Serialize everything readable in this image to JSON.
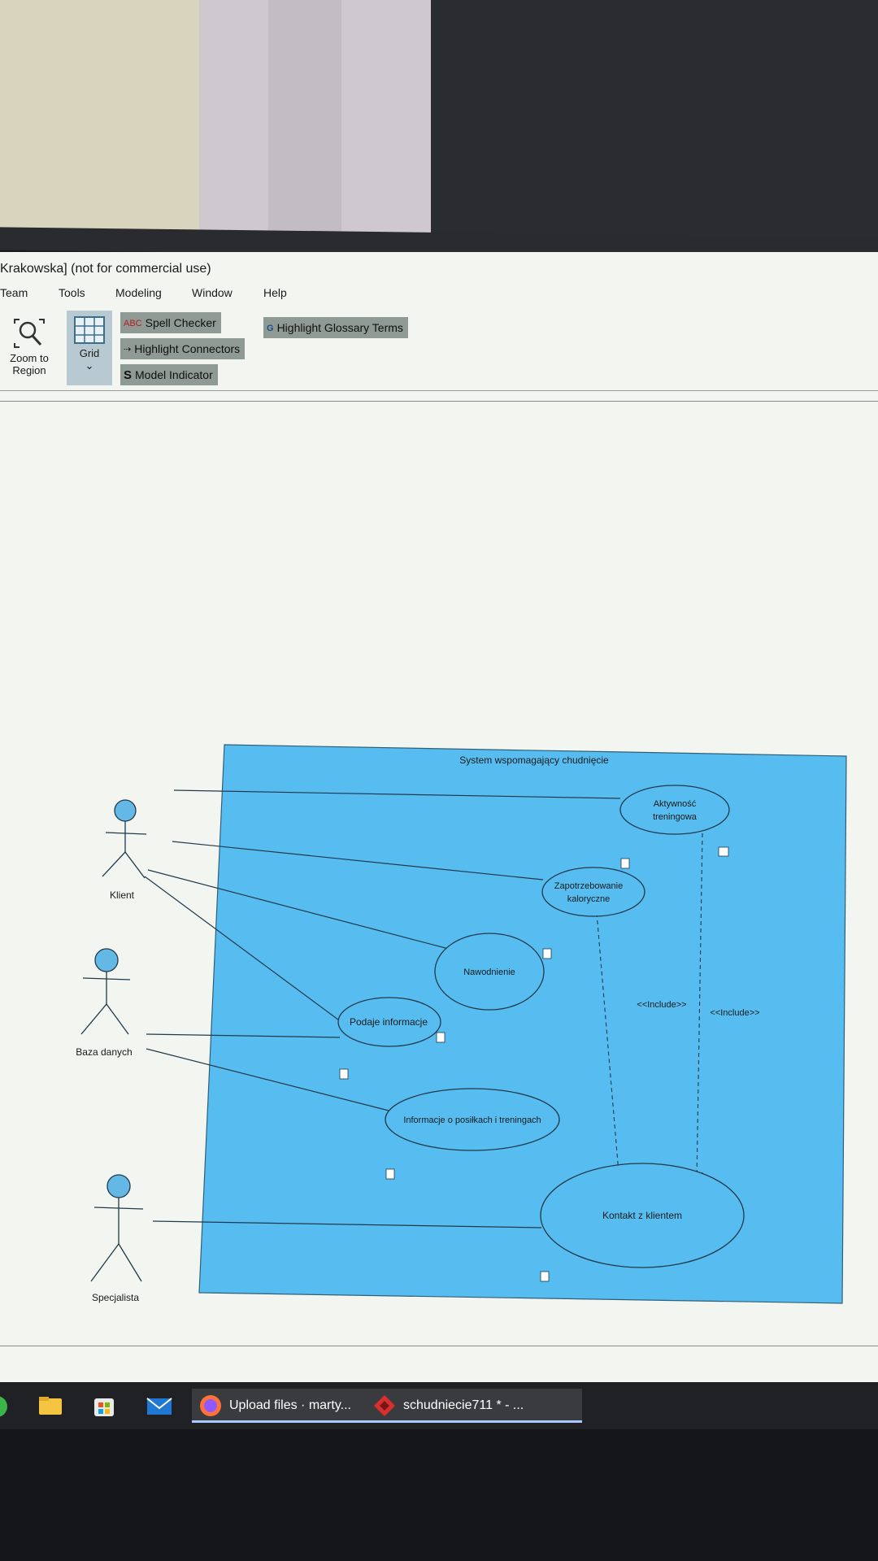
{
  "window": {
    "title": "Krakowska] (not for commercial use)"
  },
  "menu": [
    "Team",
    "Tools",
    "Modeling",
    "Window",
    "Help"
  ],
  "toolbar": {
    "zoom_label_1": "Zoom to",
    "zoom_label_2": "Region",
    "grid_label": "Grid",
    "grid_chevron": "⌄",
    "spell_checker": "Spell Checker",
    "highlight_connectors": "Highlight Connectors",
    "model_indicator": "Model Indicator",
    "highlight_glossary": "Highlight Glossary Terms"
  },
  "diagram": {
    "system_title": "System wspomagający chudnięcie",
    "actors": {
      "klient": "Klient",
      "baza": "Baza danych",
      "specjalista": "Specjalista"
    },
    "use_cases": {
      "aktywnosc_1": "Aktywność",
      "aktywnosc_2": "treningowa",
      "zapotrzebowanie_1": "Zapotrzebowanie",
      "zapotrzebowanie_2": "kaloryczne",
      "nawodnienie": "Nawodnienie",
      "podaje": "Podaje informacje",
      "informacje": "Informacje o posiłkach i treningach",
      "kontakt": "Kontakt z klientem"
    },
    "include_1": "<<Include>>",
    "include_2": "<<Include>>",
    "colors": {
      "system_fill": "#57bdf0",
      "actor_head": "#64b8e6",
      "line": "#1f3a4a"
    }
  },
  "taskbar": {
    "firefox": "Upload files · marty...",
    "app": "schudniecie711 * - ..."
  }
}
